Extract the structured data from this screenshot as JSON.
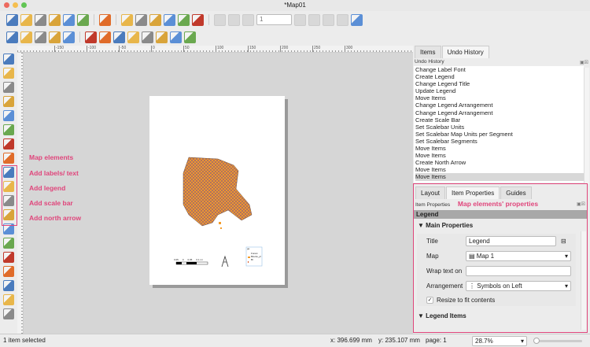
{
  "window": {
    "title": "*Map01"
  },
  "toolbar1": {
    "icons": [
      "save-icon",
      "new-layout-icon",
      "duplicate-layout-icon",
      "layout-manager-icon",
      "open-folder-icon",
      "save-as-template-icon",
      "sep",
      "add-pages-icon",
      "sep",
      "print-icon",
      "export-image-icon",
      "export-svg-icon",
      "export-pdf-icon",
      "undo-icon",
      "redo-icon",
      "sep",
      "atlas-icon",
      "first-feature-icon",
      "previous-feature-icon"
    ],
    "icons_after": [
      "next-feature-icon",
      "last-feature-icon",
      "print-atlas-icon",
      "export-atlas-icon",
      "atlas-settings-icon"
    ],
    "page_value": "1"
  },
  "toolbar2": {
    "icons": [
      "zoom-in-icon",
      "zoom-out-icon",
      "zoom-full-icon",
      "zoom-actual-icon",
      "refresh-icon",
      "sep",
      "raise-items-icon",
      "lower-items-icon",
      "group-icon",
      "ungroup-icon",
      "align-icon",
      "distribute-icon",
      "resize-icon",
      "lock-icon"
    ]
  },
  "ruler": {
    "labels": [
      "-150",
      "-100",
      "-50",
      "0",
      "50",
      "100",
      "150",
      "200",
      "250",
      "300"
    ]
  },
  "left_toolbar": {
    "icons": [
      "pan-icon",
      "zoom-tool-icon",
      "select-move-icon",
      "move-content-icon",
      "edit-nodes-icon",
      "add-map-icon",
      "add-3d-map-icon",
      "add-picture-icon",
      "add-label-icon",
      "add-legend-icon",
      "add-scale-bar-icon",
      "add-north-arrow-icon",
      "add-shape-icon",
      "add-marker-icon",
      "add-arrow-icon",
      "add-node-item-icon",
      "add-html-icon",
      "add-attribute-table-icon",
      "add-fixed-table-icon"
    ]
  },
  "annotations": {
    "map_elements": "Map elements",
    "labels": "Add labels/ text",
    "legend": "Add legend",
    "scalebar": "Add scale bar",
    "north": "Add north arrow",
    "props": "Map elements' properties"
  },
  "page": {
    "scale_labels": [
      "0.05",
      "0",
      "0.05",
      "0.1 mi"
    ],
    "legend_title": "ge",
    "legend_items": [
      "Forest",
      "Blocks_pl",
      "Bl"
    ],
    "north_label": "A"
  },
  "panel": {
    "tabs_top": [
      "Items",
      "Undo History"
    ],
    "undo_header": "Undo History",
    "undo_items": [
      "Change Label Font",
      "Create Legend",
      "Change Legend Title",
      "Update Legend",
      "Move Items",
      "Change Legend Arrangement",
      "Change Legend Arrangement",
      "Create Scale Bar",
      "Set Scalebar Units",
      "Set Scalebar Map Units per Segment",
      "Set Scalebar Segments",
      "Move Items",
      "Move Items",
      "Create North Arrow",
      "Move Items",
      "Move Items"
    ],
    "tabs_bottom": [
      "Layout",
      "Item Properties",
      "Guides"
    ],
    "props_header": "Item Properties",
    "section": "Legend",
    "main_props": {
      "title": "Main Properties",
      "title_label": "Title",
      "title_value": "Legend",
      "map_label": "Map",
      "map_value": "Map 1",
      "wrap_label": "Wrap text on",
      "wrap_value": "",
      "arr_label": "Arrangement",
      "arr_value": "Symbols on Left",
      "resize_label": "Resize to fit contents",
      "resize_checked": true
    },
    "legend_items_title": "Legend Items"
  },
  "status": {
    "selection": "1 item selected",
    "x": "x: 396.699 mm",
    "y": "y: 235.107 mm",
    "page": "page: 1",
    "zoom": "28.7%"
  },
  "colors": {
    "accent": "#e0457b",
    "map_fill": "#f39c2b"
  }
}
